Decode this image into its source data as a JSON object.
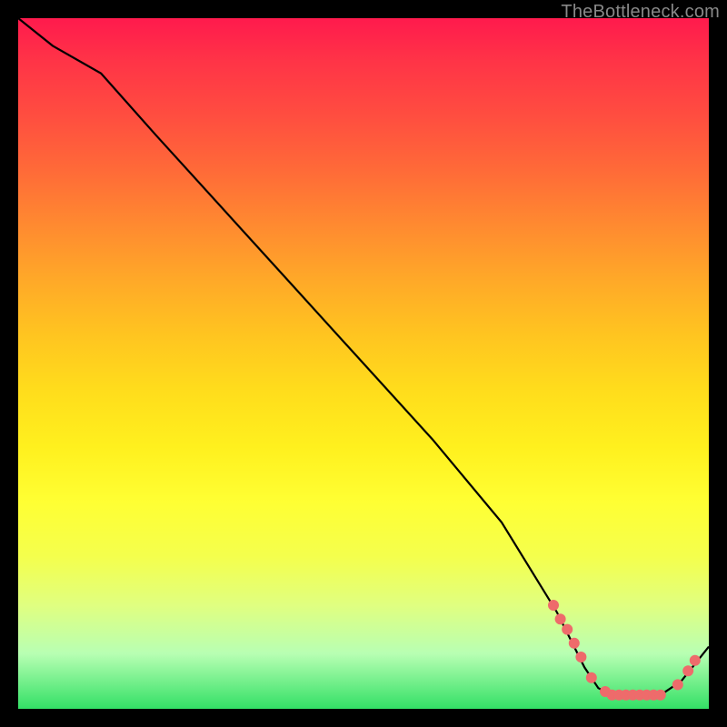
{
  "watermark": "TheBottleneck.com",
  "chart_data": {
    "type": "line",
    "title": "",
    "xlabel": "",
    "ylabel": "",
    "xlim": [
      0,
      100
    ],
    "ylim": [
      0,
      100
    ],
    "series": [
      {
        "name": "curve",
        "x": [
          0,
          5,
          12,
          20,
          30,
          40,
          50,
          60,
          70,
          78,
          82,
          84,
          86,
          88,
          90,
          93,
          96,
          100
        ],
        "y": [
          100,
          96,
          92,
          83,
          72,
          61,
          50,
          39,
          27,
          14,
          6,
          3,
          2,
          2,
          2,
          2,
          4,
          9
        ]
      }
    ],
    "markers": [
      {
        "x": 77.5,
        "y": 15
      },
      {
        "x": 78.5,
        "y": 13
      },
      {
        "x": 79.5,
        "y": 11.5
      },
      {
        "x": 80.5,
        "y": 9.5
      },
      {
        "x": 81.5,
        "y": 7.5
      },
      {
        "x": 83,
        "y": 4.5
      },
      {
        "x": 85,
        "y": 2.5
      },
      {
        "x": 86,
        "y": 2
      },
      {
        "x": 87,
        "y": 2
      },
      {
        "x": 88,
        "y": 2
      },
      {
        "x": 89,
        "y": 2
      },
      {
        "x": 90,
        "y": 2
      },
      {
        "x": 91,
        "y": 2
      },
      {
        "x": 92,
        "y": 2
      },
      {
        "x": 93,
        "y": 2
      },
      {
        "x": 95.5,
        "y": 3.5
      },
      {
        "x": 97,
        "y": 5.5
      },
      {
        "x": 98,
        "y": 7
      }
    ],
    "colors": {
      "line": "#000000",
      "marker": "#ee6b6b",
      "gradient_top": "#ff1a4d",
      "gradient_bottom": "#33e066"
    }
  }
}
